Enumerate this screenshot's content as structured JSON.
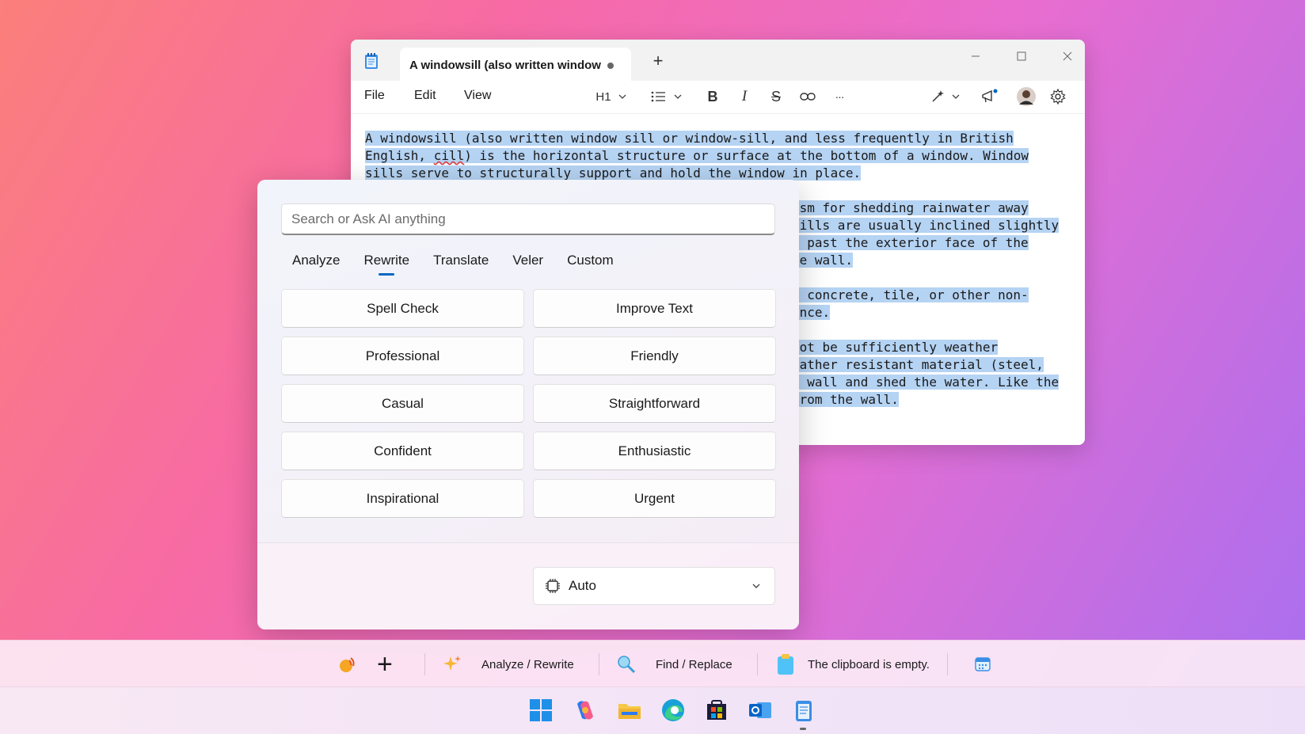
{
  "notepad": {
    "tab_title": "A windowsill (also written window",
    "new_tab": "+",
    "menu": {
      "file": "File",
      "edit": "Edit",
      "view": "View"
    },
    "toolbar": {
      "heading": "H1",
      "more": "···"
    },
    "content": {
      "p1_a": "A windowsill (also written window sill or window-sill, and less frequently in British",
      "p1_b": "English, ",
      "p1_squiggle": "cill",
      "p1_c": ") is the horizontal structure or surface at the bottom of a window. Window",
      "p1_d": "sills serve to structurally support and hold the window in place.",
      "p2_a": "ism for shedding rainwater away",
      "p2_b": " sills are usually inclined slightly",
      "p2_c": "d past the exterior face of the",
      "p2_d": "he wall.",
      "p3_a": ", concrete, tile, or other non-",
      "p3_b": "ance.",
      "p4_a": "not be sufficiently weather",
      "p4_b": "eather resistant material (steel,",
      "p4_c": "e wall and shed the water. Like the",
      "p4_d": "from the wall."
    }
  },
  "ai_panel": {
    "search_placeholder": "Search or Ask AI anything",
    "tabs": [
      "Analyze",
      "Rewrite",
      "Translate",
      "Veler",
      "Custom"
    ],
    "active_tab": "Rewrite",
    "actions": [
      "Spell Check",
      "Improve Text",
      "Professional",
      "Friendly",
      "Casual",
      "Straightforward",
      "Confident",
      "Enthusiastic",
      "Inspirational",
      "Urgent"
    ],
    "model": "Auto"
  },
  "bottom_bar": {
    "plus": "+",
    "analyze_rewrite": "Analyze / Rewrite",
    "find_replace": "Find / Replace",
    "clipboard": "The clipboard is empty."
  },
  "colors": {
    "accent": "#0067c0",
    "selection": "#b5d3f3"
  }
}
